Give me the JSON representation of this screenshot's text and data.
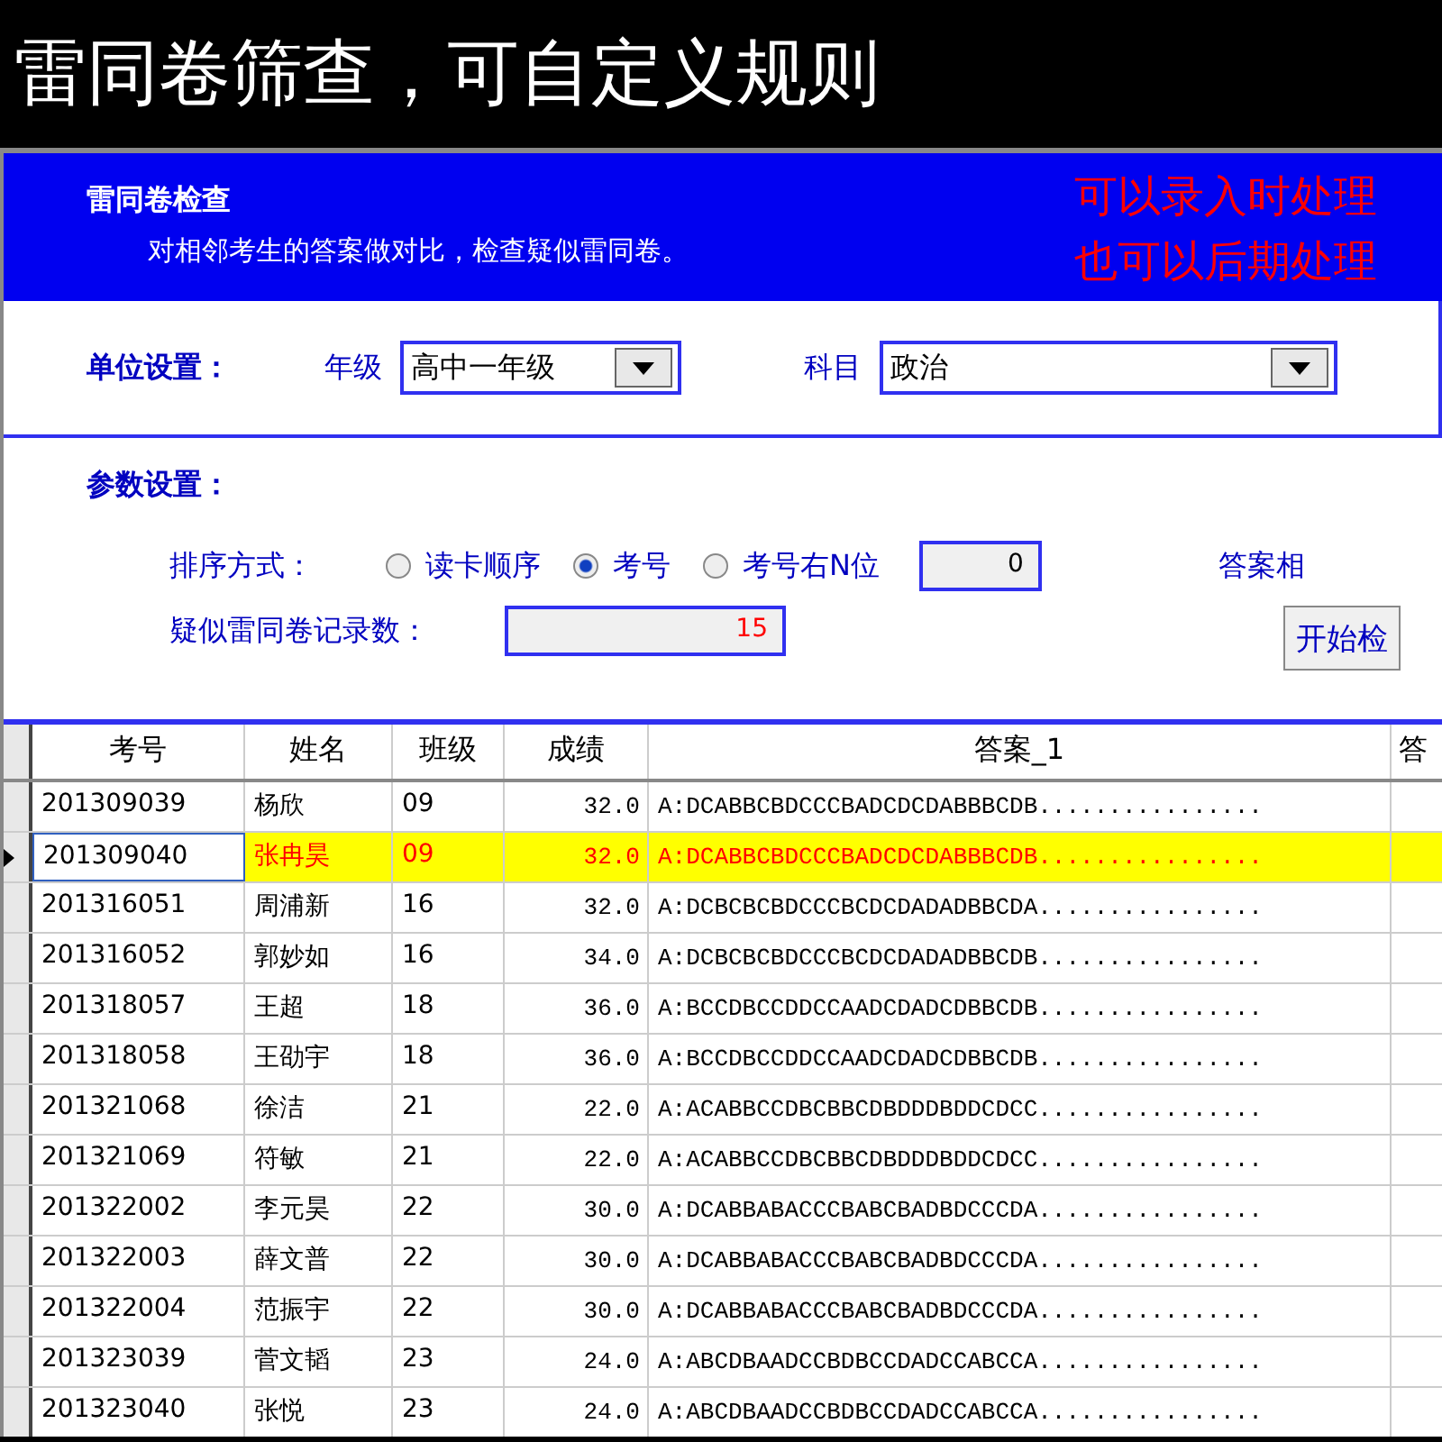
{
  "banner": {
    "title": "雷同卷筛查，可自定义规则"
  },
  "header": {
    "title": "雷同卷检查",
    "description": "对相邻考生的答案做对比，检查疑似雷同卷。",
    "notes": [
      "可以录入时处理",
      "也可以后期处理"
    ]
  },
  "unit_settings": {
    "label": "单位设置：",
    "grade_label": "年级",
    "grade_value": "高中一年级",
    "subject_label": "科目",
    "subject_value": "政治"
  },
  "params": {
    "label": "参数设置：",
    "sort_label": "排序方式：",
    "sort_options": [
      {
        "label": "读卡顺序",
        "selected": false
      },
      {
        "label": "考号",
        "selected": true
      },
      {
        "label": "考号右N位",
        "selected": false
      }
    ],
    "n_value": "0",
    "same_label": "答案相",
    "count_label": "疑似雷同卷记录数：",
    "count_value": "15",
    "start_button": "开始检"
  },
  "table": {
    "columns": [
      "考号",
      "姓名",
      "班级",
      "成绩",
      "答案_1",
      "答"
    ],
    "rows": [
      {
        "cells": [
          "201309039",
          "杨欣",
          "09",
          "32.0",
          "A:DCABBCBDCCCBADCDCDABBBCDB................"
        ],
        "selected": false
      },
      {
        "cells": [
          "201309040",
          "张冉昊",
          "09",
          "32.0",
          "A:DCABBCBDCCCBADCDCDABBBCDB................"
        ],
        "selected": true
      },
      {
        "cells": [
          "201316051",
          "周浦新",
          "16",
          "32.0",
          "A:DCBCBCBDCCCBCDCDADADBBCDA................"
        ],
        "selected": false
      },
      {
        "cells": [
          "201316052",
          "郭妙如",
          "16",
          "34.0",
          "A:DCBCBCBDCCCBCDCDADADBBCDB................"
        ],
        "selected": false
      },
      {
        "cells": [
          "201318057",
          "王超",
          "18",
          "36.0",
          "A:BCCDBCCDDCCAADCDADCDBBCDB................"
        ],
        "selected": false
      },
      {
        "cells": [
          "201318058",
          "王劭宇",
          "18",
          "36.0",
          "A:BCCDBCCDDCCAADCDADCDBBCDB................"
        ],
        "selected": false
      },
      {
        "cells": [
          "201321068",
          "徐洁",
          "21",
          "22.0",
          "A:ACABBCCDBCBBCDBDDDBDDCDCC................"
        ],
        "selected": false
      },
      {
        "cells": [
          "201321069",
          "符敏",
          "21",
          "22.0",
          "A:ACABBCCDBCBBCDBDDDBDDCDCC................"
        ],
        "selected": false
      },
      {
        "cells": [
          "201322002",
          "李元昊",
          "22",
          "30.0",
          "A:DCABBABACCCBABCBADBDCCCDA................"
        ],
        "selected": false
      },
      {
        "cells": [
          "201322003",
          "薛文普",
          "22",
          "30.0",
          "A:DCABBABACCCBABCBADBDCCCDA................"
        ],
        "selected": false
      },
      {
        "cells": [
          "201322004",
          "范振宇",
          "22",
          "30.0",
          "A:DCABBABACCCBABCBADBDCCCDA................"
        ],
        "selected": false
      },
      {
        "cells": [
          "201323039",
          "菅文韬",
          "23",
          "24.0",
          "A:ABCDBAADCCBDBCCDADCCABCCA................"
        ],
        "selected": false
      },
      {
        "cells": [
          "201323040",
          "张悦",
          "23",
          "24.0",
          "A:ABCDBAADCCBDBCCDADCCABCCA................"
        ],
        "selected": false
      }
    ]
  }
}
